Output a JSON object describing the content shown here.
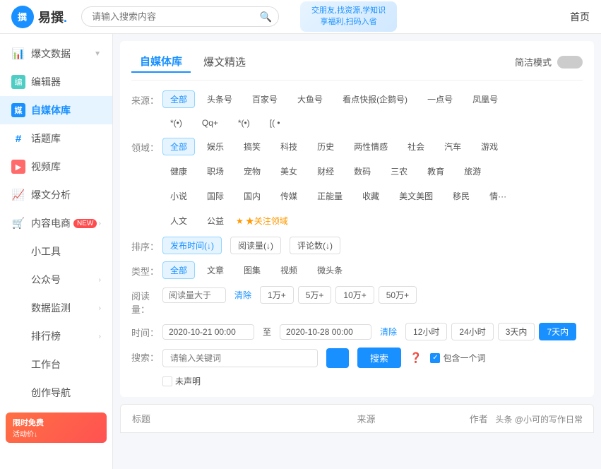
{
  "topNav": {
    "logo": "易撰",
    "logoIcon": "撰",
    "searchPlaceholder": "请输入搜索内容",
    "banner": "交朋友,找资源,学知识\n享福利,扫码入省",
    "homeLabel": "首页"
  },
  "sidebar": {
    "items": [
      {
        "id": "baowendata",
        "icon": "📊",
        "label": "爆文数据",
        "arrow": true,
        "active": false
      },
      {
        "id": "bianjiqqi",
        "icon": "✂️",
        "label": "编辑器",
        "arrow": false,
        "active": false
      },
      {
        "id": "zimeiti",
        "icon": "🎵",
        "label": "自媒体库",
        "arrow": false,
        "active": true
      },
      {
        "id": "huatiku",
        "icon": "#",
        "label": "话题库",
        "arrow": false,
        "active": false
      },
      {
        "id": "shipinku",
        "icon": "▶",
        "label": "视频库",
        "arrow": false,
        "active": false
      },
      {
        "id": "baowen-analysis",
        "icon": "📈",
        "label": "爆文分析",
        "arrow": false,
        "active": false
      },
      {
        "id": "neirongecom",
        "icon": "🛒",
        "label": "内容电商",
        "badge": "NEW",
        "arrow": true,
        "active": false
      },
      {
        "id": "xiaogongju",
        "icon": "",
        "label": "小工具",
        "arrow": false,
        "active": false
      },
      {
        "id": "gongzhonghao",
        "icon": "",
        "label": "公众号",
        "arrow": true,
        "active": false
      },
      {
        "id": "shujujiankong",
        "icon": "",
        "label": "数据监测",
        "arrow": true,
        "active": false
      },
      {
        "id": "paihangbang",
        "icon": "",
        "label": "排行榜",
        "arrow": true,
        "active": false
      },
      {
        "id": "gongtai",
        "icon": "",
        "label": "工作台",
        "arrow": false,
        "active": false
      },
      {
        "id": "chuangzuodaohang",
        "icon": "",
        "label": "创作导航",
        "arrow": false,
        "active": false
      }
    ]
  },
  "tabs": {
    "items": [
      {
        "id": "zimeiti",
        "label": "自媒体库",
        "active": true
      },
      {
        "id": "baowen-jingxuan",
        "label": "爆文精选",
        "active": false
      }
    ],
    "toggleLabel": "简洁模式"
  },
  "filters": {
    "sourceLabel": "来源：",
    "sources": [
      {
        "label": "全部",
        "active": true
      },
      {
        "label": "头条号",
        "active": false
      },
      {
        "label": "百家号",
        "active": false
      },
      {
        "label": "大鱼号",
        "active": false
      },
      {
        "label": "看点快报(企鹅号)",
        "active": false
      },
      {
        "label": "一点号",
        "active": false
      },
      {
        "label": "凤凰号",
        "active": false
      }
    ],
    "sourcesRow2": [
      {
        "label": "*(•)",
        "active": false
      },
      {
        "label": "Qq+",
        "active": false
      },
      {
        "label": "*(•)",
        "active": false
      },
      {
        "label": "[(•",
        "active": false
      }
    ],
    "domainLabel": "领域：",
    "domains": [
      {
        "label": "全部",
        "active": true
      },
      {
        "label": "娱乐",
        "active": false
      },
      {
        "label": "搞笑",
        "active": false
      },
      {
        "label": "科技",
        "active": false
      },
      {
        "label": "历史",
        "active": false
      },
      {
        "label": "两性情感",
        "active": false
      },
      {
        "label": "社会",
        "active": false
      },
      {
        "label": "汽车",
        "active": false
      },
      {
        "label": "游戏",
        "active": false
      }
    ],
    "domainsRow2": [
      {
        "label": "健康",
        "active": false
      },
      {
        "label": "职场",
        "active": false
      },
      {
        "label": "宠物",
        "active": false
      },
      {
        "label": "美女",
        "active": false
      },
      {
        "label": "财经",
        "active": false
      },
      {
        "label": "数码",
        "active": false
      },
      {
        "label": "三农",
        "active": false
      },
      {
        "label": "教育",
        "active": false
      },
      {
        "label": "旅游",
        "active": false
      }
    ],
    "domainsRow3": [
      {
        "label": "小说",
        "active": false
      },
      {
        "label": "国际",
        "active": false
      },
      {
        "label": "国内",
        "active": false
      },
      {
        "label": "传媒",
        "active": false
      },
      {
        "label": "正能量",
        "active": false
      },
      {
        "label": "收藏",
        "active": false
      },
      {
        "label": "美文美图",
        "active": false
      },
      {
        "label": "移民",
        "active": false
      },
      {
        "label": "情...",
        "active": false
      }
    ],
    "domainsRow4": [
      {
        "label": "人文",
        "active": false
      },
      {
        "label": "公益",
        "active": false
      }
    ],
    "domainLinkLabel": "★关注领域",
    "sortLabel": "排序：",
    "sorts": [
      {
        "label": "发布时间(↓)",
        "active": true
      },
      {
        "label": "阅读量(↓)",
        "active": false
      },
      {
        "label": "评论数(↓)",
        "active": false
      }
    ],
    "typeLabel": "类型：",
    "types": [
      {
        "label": "全部",
        "active": true
      },
      {
        "label": "文章",
        "active": false
      },
      {
        "label": "图集",
        "active": false
      },
      {
        "label": "视频",
        "active": false
      },
      {
        "label": "微头条",
        "active": false
      }
    ],
    "readLabel": "阅读量：",
    "readPlaceholder": "阅读量大于",
    "readClear": "清除",
    "readOptions": [
      "1万+",
      "5万+",
      "10万+",
      "50万+"
    ],
    "timeLabel": "时间：",
    "timeStart": "2020-10-21 00:00",
    "timeSep": "至",
    "timeEnd": "2020-10-28 00:00",
    "timeClear": "清除",
    "timeOptions": [
      "12小时",
      "24小时",
      "3天内",
      "7天内"
    ],
    "timeActiveIndex": 3,
    "searchLabel": "搜索：",
    "searchPlaceholder": "请输入关键词",
    "searchBtnLabel": "搜索",
    "searchHelpIcon": "?",
    "containLabel": "包含一个词",
    "declareLabel": "未声明"
  },
  "table": {
    "columns": [
      {
        "id": "title",
        "label": "标题"
      },
      {
        "id": "source",
        "label": "来源"
      },
      {
        "id": "author",
        "label": "作者"
      }
    ]
  },
  "watermark": "头条 @小可的写作日常",
  "promo": {
    "label": "限时免费",
    "subLabel": "活动价↓"
  }
}
